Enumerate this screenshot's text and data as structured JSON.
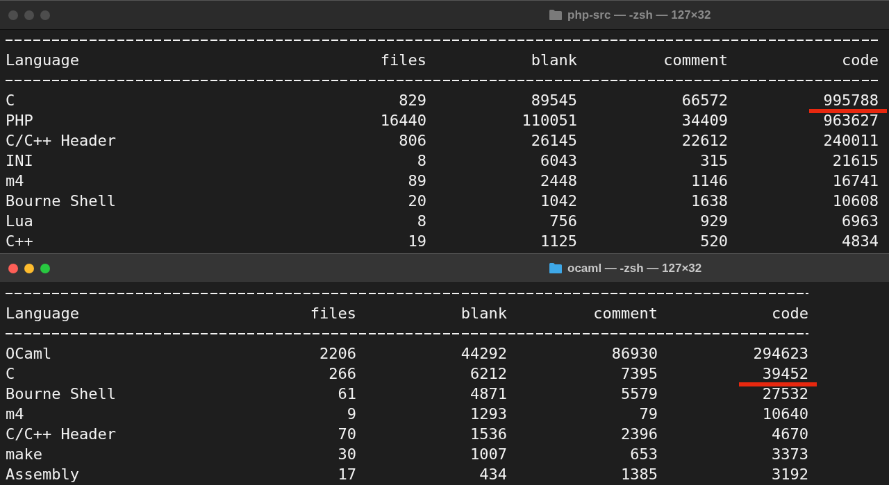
{
  "windows": [
    {
      "title": "php-src — -zsh — 127×32",
      "active": false,
      "table": {
        "columns": [
          "Language",
          "files",
          "blank",
          "comment",
          "code"
        ],
        "rows": [
          {
            "cells": [
              "C",
              "829",
              "89545",
              "66572",
              "995788"
            ],
            "code_underlined": true
          },
          {
            "cells": [
              "PHP",
              "16440",
              "110051",
              "34409",
              "963627"
            ],
            "code_underlined": false
          },
          {
            "cells": [
              "C/C++ Header",
              "806",
              "26145",
              "22612",
              "240011"
            ],
            "code_underlined": false
          },
          {
            "cells": [
              "INI",
              "8",
              "6043",
              "315",
              "21615"
            ],
            "code_underlined": false
          },
          {
            "cells": [
              "m4",
              "89",
              "2448",
              "1146",
              "16741"
            ],
            "code_underlined": false
          },
          {
            "cells": [
              "Bourne Shell",
              "20",
              "1042",
              "1638",
              "10608"
            ],
            "code_underlined": false
          },
          {
            "cells": [
              "Lua",
              "8",
              "756",
              "929",
              "6963"
            ],
            "code_underlined": false
          },
          {
            "cells": [
              "C++",
              "19",
              "1125",
              "520",
              "4834"
            ],
            "code_underlined": false
          }
        ]
      }
    },
    {
      "title": "ocaml — -zsh — 127×32",
      "active": true,
      "table": {
        "columns": [
          "Language",
          "files",
          "blank",
          "comment",
          "code"
        ],
        "rows": [
          {
            "cells": [
              "OCaml",
              "2206",
              "44292",
              "86930",
              "294623"
            ],
            "code_underlined": false
          },
          {
            "cells": [
              "C",
              "266",
              "6212",
              "7395",
              "39452"
            ],
            "code_underlined": true
          },
          {
            "cells": [
              "Bourne Shell",
              "61",
              "4871",
              "5579",
              "27532"
            ],
            "code_underlined": false
          },
          {
            "cells": [
              "m4",
              "9",
              "1293",
              "79",
              "10640"
            ],
            "code_underlined": false
          },
          {
            "cells": [
              "C/C++ Header",
              "70",
              "1536",
              "2396",
              "4670"
            ],
            "code_underlined": false
          },
          {
            "cells": [
              "make",
              "30",
              "1007",
              "653",
              "3373"
            ],
            "code_underlined": false
          },
          {
            "cells": [
              "Assembly",
              "17",
              "434",
              "1385",
              "3192"
            ],
            "code_underlined": false
          }
        ]
      }
    }
  ]
}
